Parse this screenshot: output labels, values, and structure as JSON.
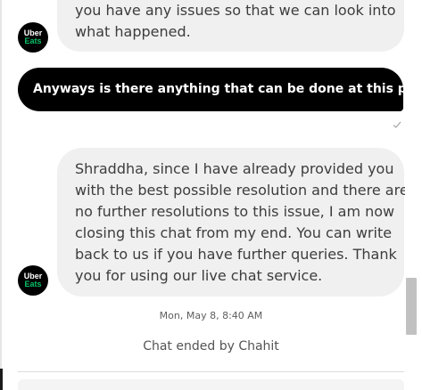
{
  "messages": {
    "top_agent": {
      "lines": [
        "you have any issues so that we can look into",
        "what happened."
      ]
    },
    "user": {
      "text": "Anyways is there anything that can be done at this point ?"
    },
    "main_agent": {
      "lines": [
        "Shraddha, since I have already provided you",
        "with the best possible resolution and there are",
        "no further resolutions to this issue, I am now",
        "closing this chat from my end. You can write",
        "back to us if you have further queries. Thank",
        "you for using our live chat service."
      ]
    }
  },
  "avatar": {
    "line1": "Uber",
    "line2": "Eats"
  },
  "timestamp": "Mon, May 8, 8:40 AM",
  "status": "Chat ended by Chahit",
  "colors": {
    "user_bubble": "#000000",
    "agent_bubble": "#f0f0f0",
    "eats_green": "#06c167"
  },
  "icons": {
    "read_receipt": "check-icon"
  }
}
